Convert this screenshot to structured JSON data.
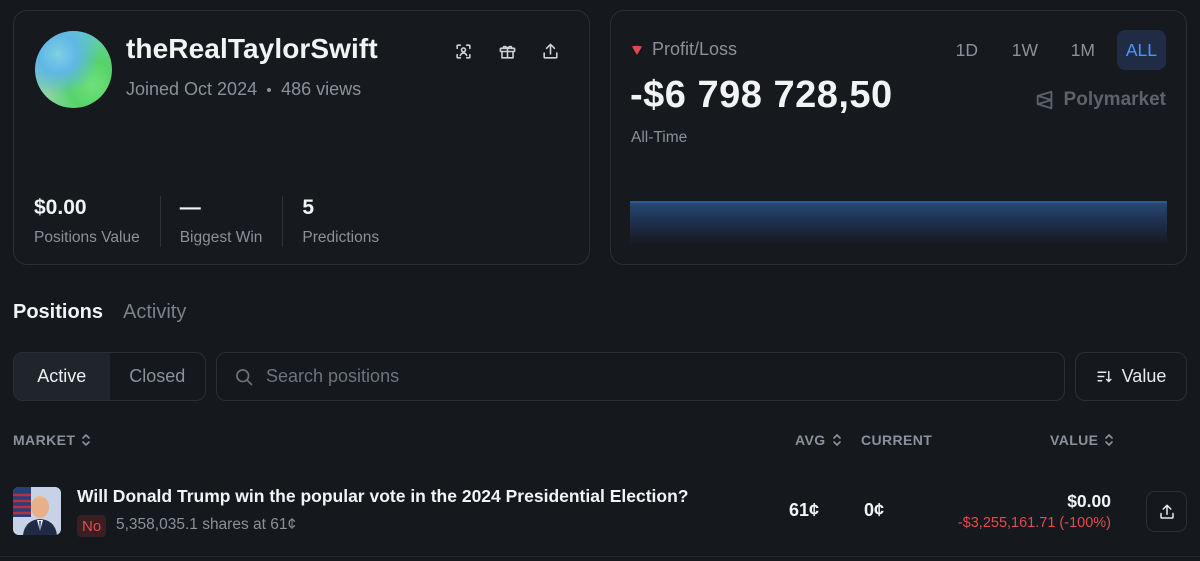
{
  "profile": {
    "username": "theRealTaylorSwift",
    "joined": "Joined Oct 2024",
    "views": "486 views",
    "icons": [
      "scan-icon",
      "gift-icon",
      "share-icon"
    ],
    "stats": [
      {
        "value": "$0.00",
        "label": "Positions Value"
      },
      {
        "value": "—",
        "label": "Biggest Win"
      },
      {
        "value": "5",
        "label": "Predictions"
      }
    ]
  },
  "pnl": {
    "label": "Profit/Loss",
    "value": "-$6 798 728,50",
    "period": "All-Time",
    "ranges": [
      "1D",
      "1W",
      "1M",
      "ALL"
    ],
    "active_range": "ALL",
    "brand": "Polymarket"
  },
  "tabs": {
    "positions": "Positions",
    "activity": "Activity"
  },
  "filters": {
    "active": "Active",
    "closed": "Closed"
  },
  "search": {
    "placeholder": "Search positions"
  },
  "sort": {
    "label": "Value"
  },
  "table": {
    "headers": {
      "market": "MARKET",
      "avg": "AVG",
      "current": "CURRENT",
      "value": "VALUE"
    },
    "rows": [
      {
        "title": "Will Donald Trump win the popular vote in the 2024 Presidential Election?",
        "outcome": "No",
        "shares": "5,358,035.1 shares at 61¢",
        "avg": "61¢",
        "current": "0¢",
        "value": "$0.00",
        "change": "-$3,255,161.71 (-100%)"
      }
    ]
  },
  "colors": {
    "accent": "#4f93ff",
    "loss": "#e04b4f",
    "bg": "#15181d"
  }
}
